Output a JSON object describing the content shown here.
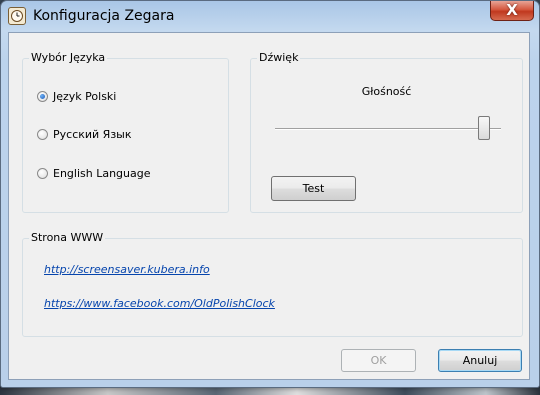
{
  "window": {
    "title": "Konfiguracja Zegara",
    "close_label": "X"
  },
  "language_group": {
    "label": "Wybór Języka",
    "options": [
      {
        "label": "Język Polski",
        "checked": true
      },
      {
        "label": "Русский Язык",
        "checked": false
      },
      {
        "label": "English Language",
        "checked": false
      }
    ]
  },
  "sound_group": {
    "label": "Dźwięk",
    "volume_label": "Głośność",
    "volume_level": 0.95,
    "test_button": "Test"
  },
  "www_group": {
    "label": "Strona WWW",
    "links": [
      "http://screensaver.kubera.info",
      "https://www.facebook.com/OldPolishClock"
    ]
  },
  "footer": {
    "ok_label": "OK",
    "ok_enabled": false,
    "cancel_label": "Anuluj"
  }
}
